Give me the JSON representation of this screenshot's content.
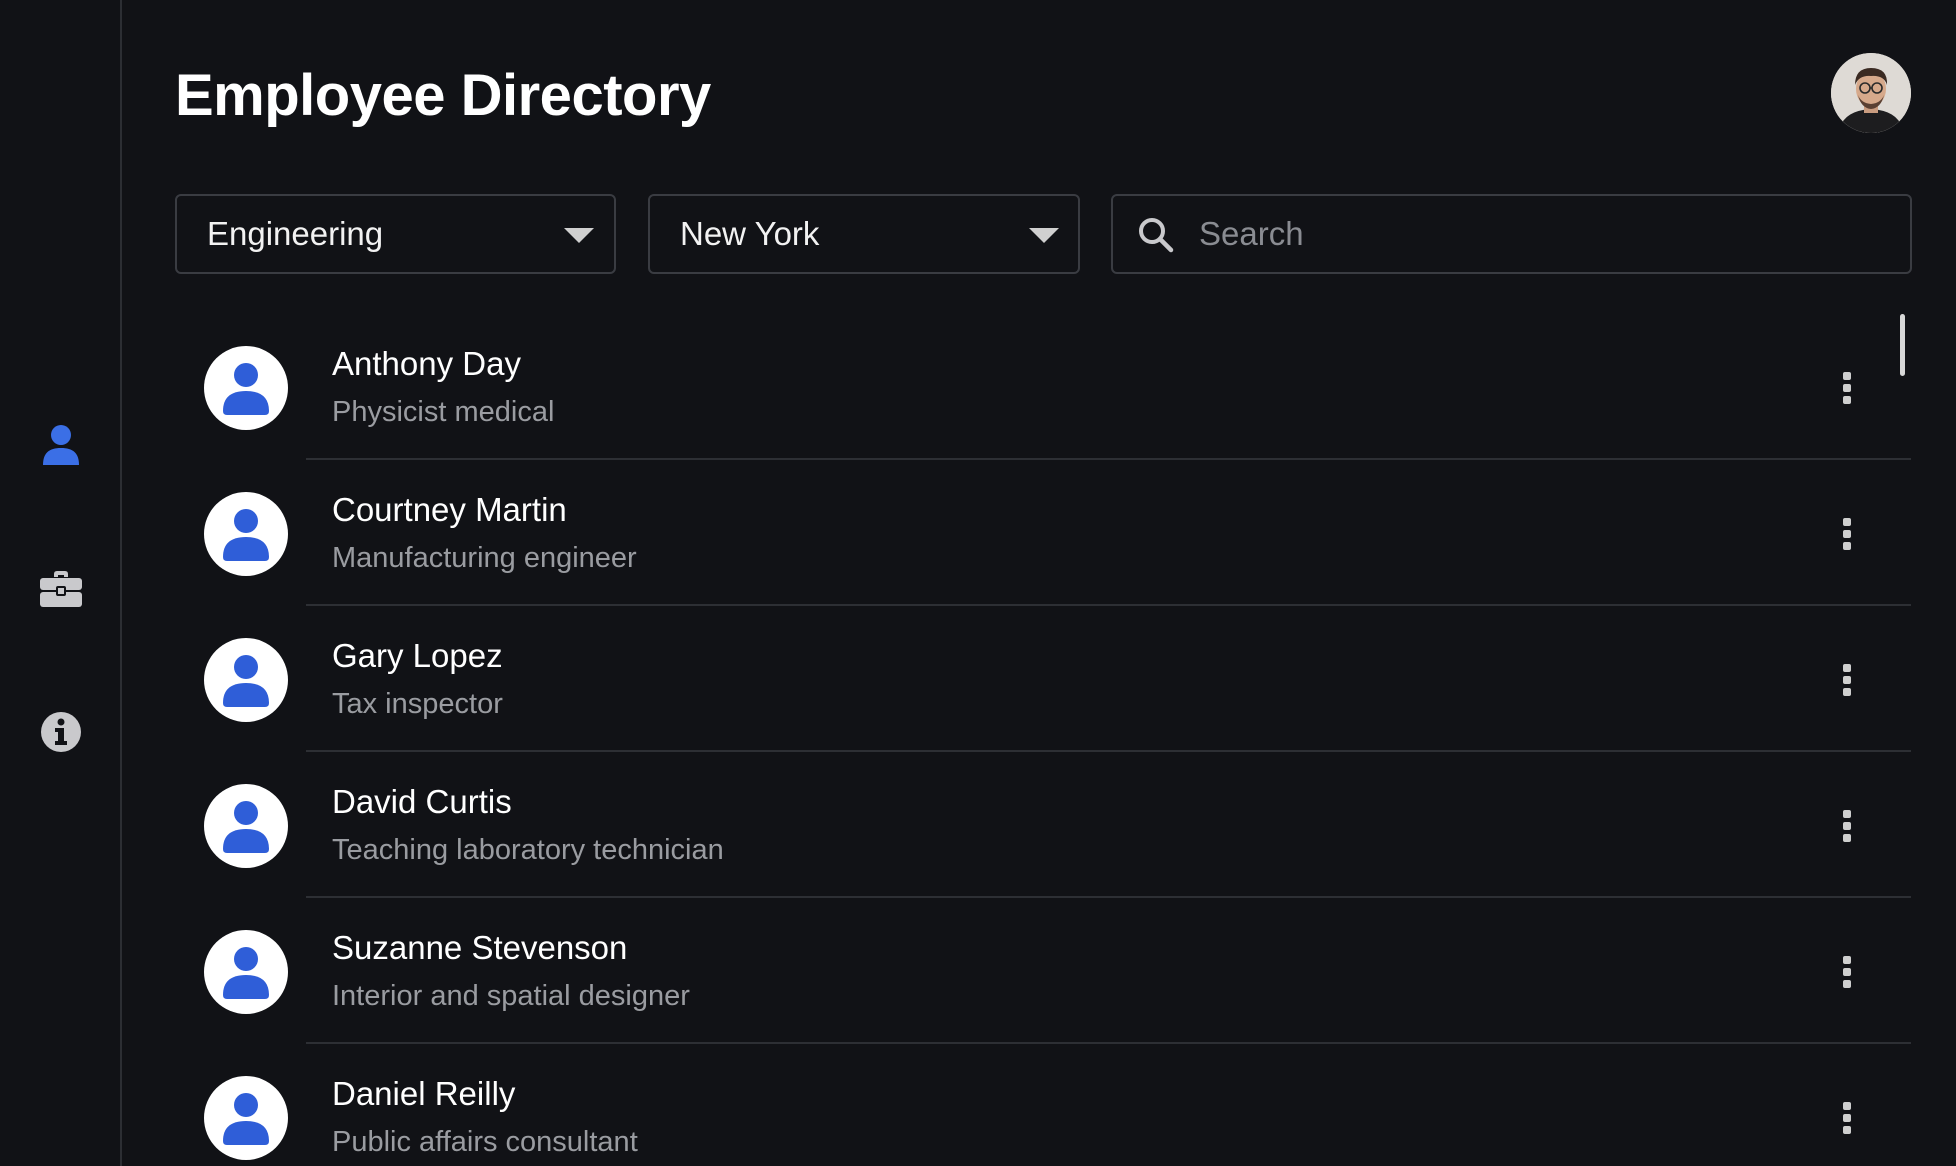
{
  "header": {
    "title": "Employee Directory"
  },
  "sidebar": {
    "items": [
      {
        "id": "employees",
        "icon": "person-icon",
        "active": true
      },
      {
        "id": "jobs",
        "icon": "briefcase-icon",
        "active": false
      },
      {
        "id": "info",
        "icon": "info-icon",
        "active": false
      }
    ]
  },
  "filters": {
    "department": {
      "selected": "Engineering"
    },
    "location": {
      "selected": "New York"
    },
    "search": {
      "placeholder": "Search",
      "value": ""
    }
  },
  "employees": [
    {
      "name": "Anthony Day",
      "title": "Physicist medical"
    },
    {
      "name": "Courtney Martin",
      "title": "Manufacturing engineer"
    },
    {
      "name": "Gary Lopez",
      "title": "Tax inspector"
    },
    {
      "name": "David Curtis",
      "title": "Teaching laboratory technician"
    },
    {
      "name": "Suzanne Stevenson",
      "title": "Interior and spatial designer"
    },
    {
      "name": "Daniel Reilly",
      "title": "Public affairs consultant"
    }
  ],
  "colors": {
    "background": "#111216",
    "accent": "#2f5ed8",
    "border": "#3a3c42",
    "muted_text": "#9a9ca1"
  }
}
